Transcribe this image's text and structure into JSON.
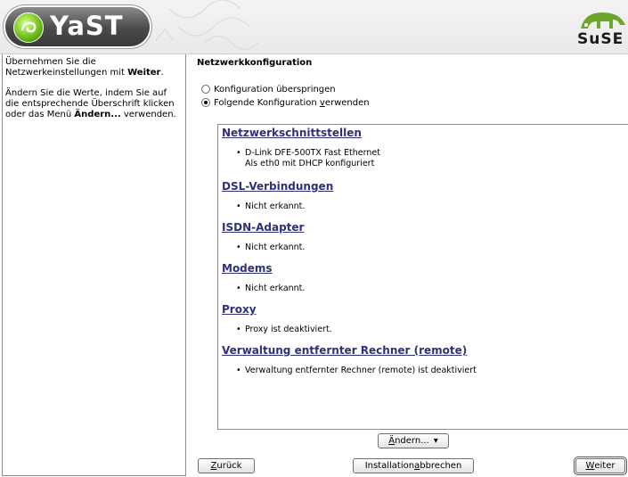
{
  "header": {
    "yast_logo_text": "YaST",
    "suse_logo_text": "SuSE"
  },
  "help": {
    "p1_a": "Übernehmen Sie die Netzwerkeinstellungen mit ",
    "p1_bold": "Weiter",
    "p1_b": ".",
    "p2_a": "Ändern Sie die Werte, indem Sie auf die entsprechende Überschrift klicken oder das Menü ",
    "p2_bold": "Ändern...",
    "p2_b": " verwenden."
  },
  "main": {
    "title": "Netzwerkkonfiguration",
    "radio_skip": "Konfiguration überspringen",
    "radio_use_pre": "Folgende Konfiguration ",
    "radio_use_ul": "v",
    "radio_use_post": "erwenden",
    "selected_radio": "use"
  },
  "summary": {
    "sections": [
      {
        "heading": "Netzwerkschnittstellen",
        "items": [
          "D-Link DFE-500TX Fast Ethernet",
          "Als eth0 mit DHCP konfiguriert"
        ]
      },
      {
        "heading": "DSL-Verbindungen",
        "items": [
          "Nicht erkannt."
        ]
      },
      {
        "heading": "ISDN-Adapter",
        "items": [
          "Nicht erkannt."
        ]
      },
      {
        "heading": "Modems",
        "items": [
          "Nicht erkannt."
        ]
      },
      {
        "heading": "Proxy",
        "items": [
          "Proxy ist deaktiviert."
        ]
      },
      {
        "heading": "Verwaltung entfernter Rechner (remote)",
        "items": [
          "Verwaltung entfernter Rechner (remote) ist deaktiviert"
        ]
      }
    ]
  },
  "buttons": {
    "change_ul": "Ä",
    "change_rest": "ndern...",
    "change_arrow": "▾",
    "back_ul": "Z",
    "back_rest": "urück",
    "abort_pre": "Installation ",
    "abort_ul": "a",
    "abort_rest": "bbrechen",
    "next_ul": "W",
    "next_rest": "eiter"
  },
  "colors": {
    "heading_link": "#30307a",
    "background": "#ffffff",
    "border": "#8c8c8c"
  },
  "icons": {
    "yast_ball": "chameleon-ball-icon",
    "suse_logo": "suse-chameleon-icon",
    "bullet": "bullet-icon",
    "dropdown": "dropdown-arrow-icon"
  }
}
